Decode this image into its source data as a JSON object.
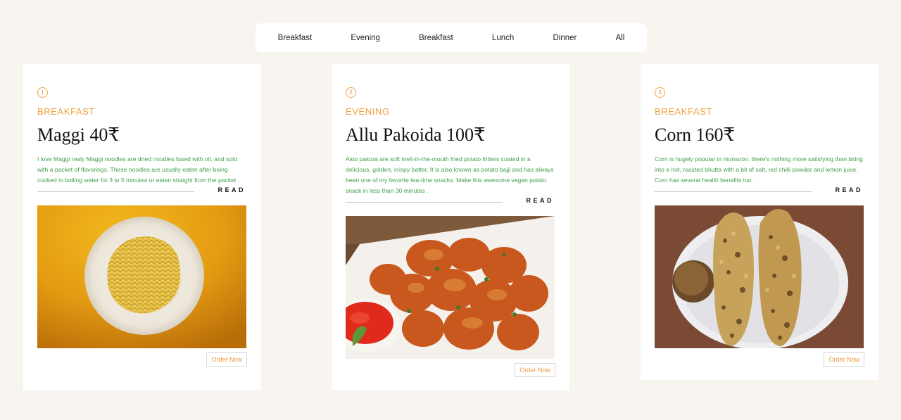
{
  "filters": [
    "Breakfast",
    "Evening",
    "Breakfast",
    "Lunch",
    "Dinner",
    "All"
  ],
  "cards": [
    {
      "number": "1",
      "category": "BREAKFAST",
      "title": "Maggi 40₹",
      "description": "I love Maggi realy Maggi noodles are dried noodles fused with oil, and sold with a packet of flavorings. These noodles are usually eaten after being cooked in boiling water for 3 to 5 minutes or eaten straight from the packet .",
      "read_label": "READ",
      "order_label": "Order Now",
      "image": "maggi-noodles-on-plate"
    },
    {
      "number": "2",
      "category": "EVENING",
      "title": "Allu Pakoida 100₹",
      "description": "Aloo pakora are soft melt-in-the-mouth fried potato fritters coated in a delicious, golden, crispy batter. It is also known as potato bajji and has always been one of my favorite tea-time snacks. Make this awesome vegan potato snack in less than 30 minutes .",
      "read_label": "READ",
      "order_label": "Order Now",
      "image": "potato-pakora-with-sauce"
    },
    {
      "number": "3",
      "category": "BREAKFAST",
      "title": "Corn 160₹",
      "description": "Corn is hugely popular in monsoon. there's nothing more satisfying than biting into a hot, roasted bhutta with a bit of salt, red chilli powder and lemon juice. Corn has several health benefits too .",
      "read_label": "READ",
      "order_label": "Order Now",
      "image": "roasted-corn-on-plate"
    }
  ]
}
